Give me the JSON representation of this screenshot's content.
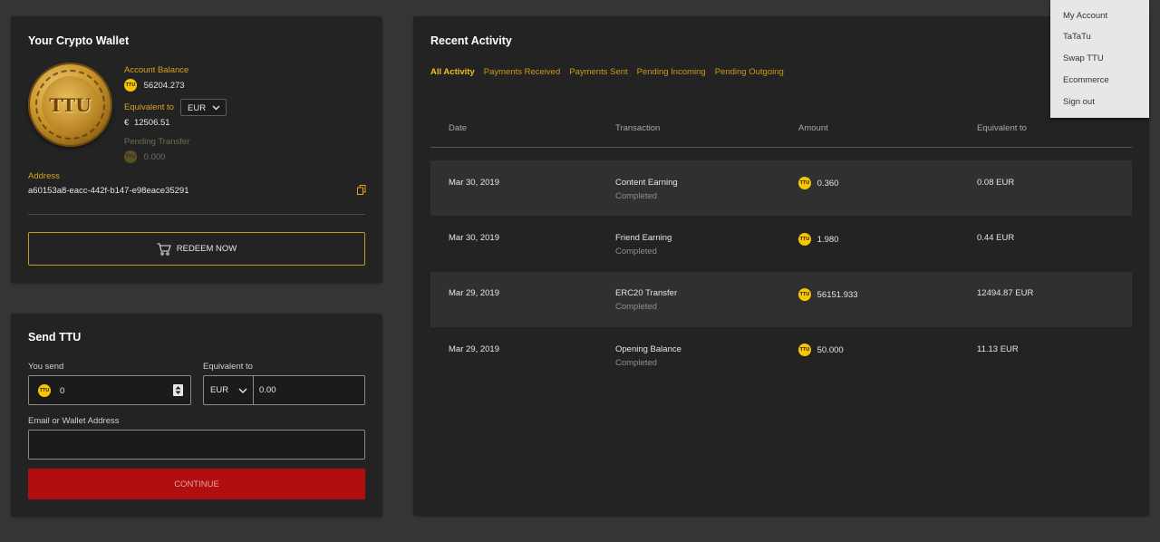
{
  "wallet": {
    "title": "Your Crypto Wallet",
    "coin_label": "TTU",
    "coin_icon_text": "TTU",
    "balance_label": "Account Balance",
    "balance_value": "56204.273",
    "equivalent_label": "Equivalent to",
    "currency": "EUR",
    "euro_symbol": "€",
    "equivalent_value": "12506.51",
    "pending_label": "Pending Transfer",
    "pending_value": "0.000",
    "address_label": "Address",
    "address_value": "a60153a8-eacc-442f-b147-e98eace35291",
    "redeem_label": "REDEEM NOW"
  },
  "send": {
    "title": "Send TTU",
    "you_send_label": "You send",
    "you_send_value": "0",
    "equivalent_label": "Equivalent to",
    "currency": "EUR",
    "equivalent_value": "0.00",
    "address_label": "Email or Wallet Address",
    "address_value": "",
    "continue_label": "CONTINUE"
  },
  "activity": {
    "title": "Recent Activity",
    "tabs": [
      "All Activity",
      "Payments Received",
      "Payments Sent",
      "Pending Incoming",
      "Pending Outgoing"
    ],
    "columns": [
      "Date",
      "Transaction",
      "Amount",
      "Equivalent to"
    ],
    "rows": [
      {
        "date": "Mar 30, 2019",
        "transaction": "Content Earning",
        "status": "Completed",
        "amount": "0.360",
        "equivalent": "0.08 EUR"
      },
      {
        "date": "Mar 30, 2019",
        "transaction": "Friend Earning",
        "status": "Completed",
        "amount": "1.980",
        "equivalent": "0.44 EUR"
      },
      {
        "date": "Mar 29, 2019",
        "transaction": "ERC20 Transfer",
        "status": "Completed",
        "amount": "56151.933",
        "equivalent": "12494.87 EUR"
      },
      {
        "date": "Mar 29, 2019",
        "transaction": "Opening Balance",
        "status": "Completed",
        "amount": "50.000",
        "equivalent": "11.13 EUR"
      }
    ]
  },
  "menu": {
    "items": [
      "My Account",
      "TaTaTu",
      "Swap TTU",
      "Ecommerce",
      "Sign out"
    ]
  },
  "colors": {
    "background": "#353535",
    "card": "#232323",
    "accent_gold": "#d9a21f",
    "coin_yellow": "#f7c600",
    "continue_red": "#b10f0f"
  }
}
